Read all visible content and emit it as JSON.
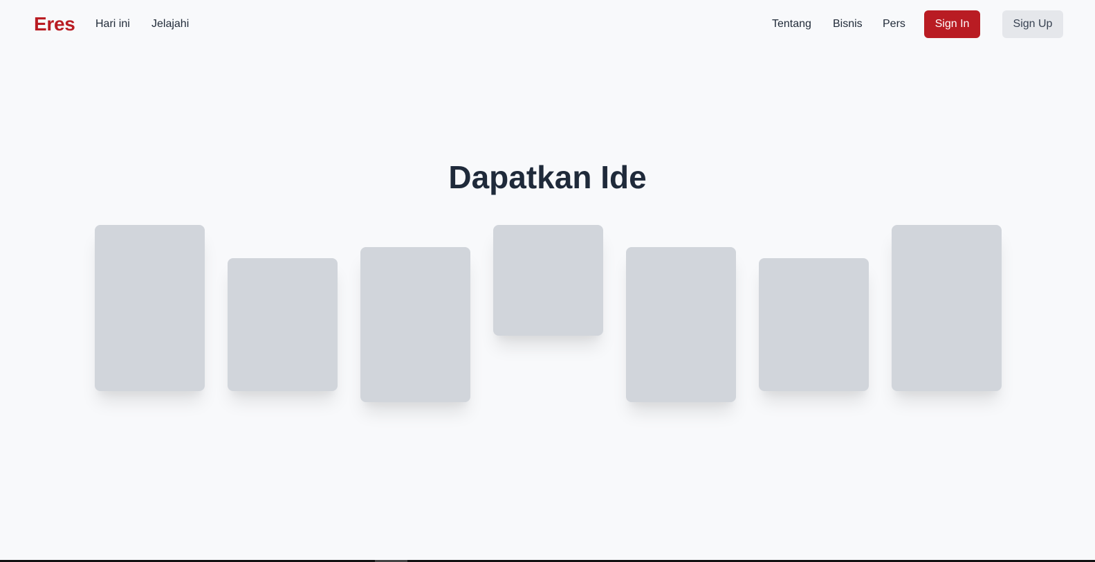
{
  "brand": {
    "name": "Eres",
    "color": "#b91c23"
  },
  "nav_left": [
    {
      "label": "Hari ini"
    },
    {
      "label": "Jelajahi"
    }
  ],
  "nav_right": [
    {
      "label": "Tentang"
    },
    {
      "label": "Bisnis"
    },
    {
      "label": "Pers"
    }
  ],
  "auth": {
    "signin_label": "Sign In",
    "signup_label": "Sign Up"
  },
  "hero": {
    "title": "Dapatkan Ide",
    "card_count": 7
  },
  "colors": {
    "accent": "#b91c23",
    "background": "#f8f9fb",
    "card_placeholder": "#d1d5db",
    "secondary_button": "#e5e7eb"
  }
}
